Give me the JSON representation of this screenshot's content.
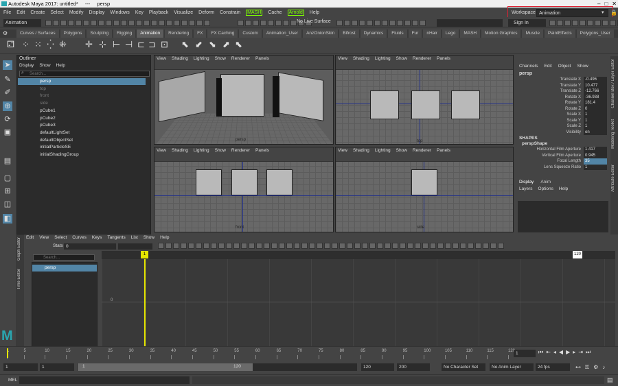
{
  "window": {
    "title": "Autodesk Maya 2017: untitled*",
    "separator": "---",
    "panel": "persp"
  },
  "menubar": [
    "File",
    "Edit",
    "Create",
    "Select",
    "Modify",
    "Display",
    "Windows",
    "Key",
    "Playback",
    "Visualize",
    "Deform",
    "Constrain",
    "MASH",
    "Cache",
    "Arnold",
    "Help"
  ],
  "workspace": {
    "label": "Workspace :",
    "value": "Animation"
  },
  "statusline": {
    "mode": "Animation",
    "live_surface": "No Live Surface",
    "sign_in": "Sign In"
  },
  "shelf_tabs": [
    "Curves / Surfaces",
    "Polygons",
    "Sculpting",
    "Rigging",
    "Animation",
    "Rendering",
    "FX",
    "FX Caching",
    "Custom",
    "Animation_User",
    "AnzOnionSkin",
    "Bifrost",
    "Dynamics",
    "Fluids",
    "Fur",
    "nHair",
    "Lego",
    "MASH",
    "Motion Graphics",
    "Muscle",
    "PaintEffects",
    "Polygons_User"
  ],
  "active_shelf": "Animation",
  "outliner": {
    "title": "Outliner",
    "menu": [
      "Display",
      "Show",
      "Help"
    ],
    "search_placeholder": "Search...",
    "items": [
      {
        "label": "persp",
        "selected": true
      },
      {
        "label": "top",
        "dim": true
      },
      {
        "label": "front",
        "dim": true
      },
      {
        "label": "side",
        "dim": true
      },
      {
        "label": "pCube1"
      },
      {
        "label": "pCube2"
      },
      {
        "label": "pCube3"
      },
      {
        "label": "defaultLightSet"
      },
      {
        "label": "defaultObjectSet"
      },
      {
        "label": "initialParticleSE"
      },
      {
        "label": "initialShadingGroup"
      }
    ]
  },
  "viewport_menu": [
    "View",
    "Shading",
    "Lighting",
    "Show",
    "Renderer",
    "Panels"
  ],
  "viewports": [
    {
      "name": "persp",
      "label": "persp"
    },
    {
      "name": "top",
      "label": "top"
    },
    {
      "name": "front",
      "label": "front"
    },
    {
      "name": "side",
      "label": "side"
    }
  ],
  "channel_box": {
    "menu": [
      "Channels",
      "Edit",
      "Object",
      "Show"
    ],
    "object": "persp",
    "attrs": [
      {
        "label": "Translate X",
        "value": "-0.496"
      },
      {
        "label": "Translate Y",
        "value": "10.477"
      },
      {
        "label": "Translate Z",
        "value": "-12.766"
      },
      {
        "label": "Rotate X",
        "value": "-36.938"
      },
      {
        "label": "Rotate Y",
        "value": "181.4"
      },
      {
        "label": "Rotate Z",
        "value": "0"
      },
      {
        "label": "Scale X",
        "value": "1"
      },
      {
        "label": "Scale Y",
        "value": "1"
      },
      {
        "label": "Scale Z",
        "value": "1"
      },
      {
        "label": "Visibility",
        "value": "on"
      }
    ],
    "shapes_title": "SHAPES",
    "shape_name": "perspShape",
    "shape_attrs": [
      {
        "label": "Horizontal Film Aperture",
        "value": "1.417"
      },
      {
        "label": "Vertical Film Aperture",
        "value": "0.945"
      },
      {
        "label": "Focal Length",
        "value": "35",
        "highlight": true
      },
      {
        "label": "Lens Squeeze Ratio",
        "value": "1"
      }
    ],
    "layer_tabs": [
      "Display",
      "Anim"
    ],
    "layer_menu": [
      "Layers",
      "Options",
      "Help"
    ]
  },
  "side_tabs": [
    "Channel Box / Layer Editor",
    "Modeling Toolkit",
    "Attribute Editor"
  ],
  "graph_editor": {
    "side_tabs": [
      "Graph Editor",
      "Time Editor"
    ],
    "menu": [
      "Edit",
      "View",
      "Select",
      "Curves",
      "Keys",
      "Tangents",
      "List",
      "Show",
      "Help"
    ],
    "stats_label": "Stats",
    "stats_value": "0",
    "outliner_item": "persp",
    "search_placeholder": "Search...",
    "current_frame": "1",
    "end_frame": "120",
    "y_zero": "0"
  },
  "time_slider": {
    "ticks": [
      "1",
      "5",
      "10",
      "15",
      "20",
      "25",
      "30",
      "35",
      "40",
      "45",
      "50",
      "55",
      "60",
      "65",
      "70",
      "75",
      "80",
      "85",
      "90",
      "95",
      "100",
      "105",
      "110",
      "115",
      "120"
    ],
    "current": "1"
  },
  "range": {
    "start": "1",
    "inner_start": "1",
    "slider_start": "1",
    "slider_end": "120",
    "inner_end": "120",
    "end": "200",
    "character_set": "No Character Set",
    "anim_layer": "No Anim Layer",
    "fps": "24 fps"
  },
  "command_line": {
    "label": "MEL"
  }
}
